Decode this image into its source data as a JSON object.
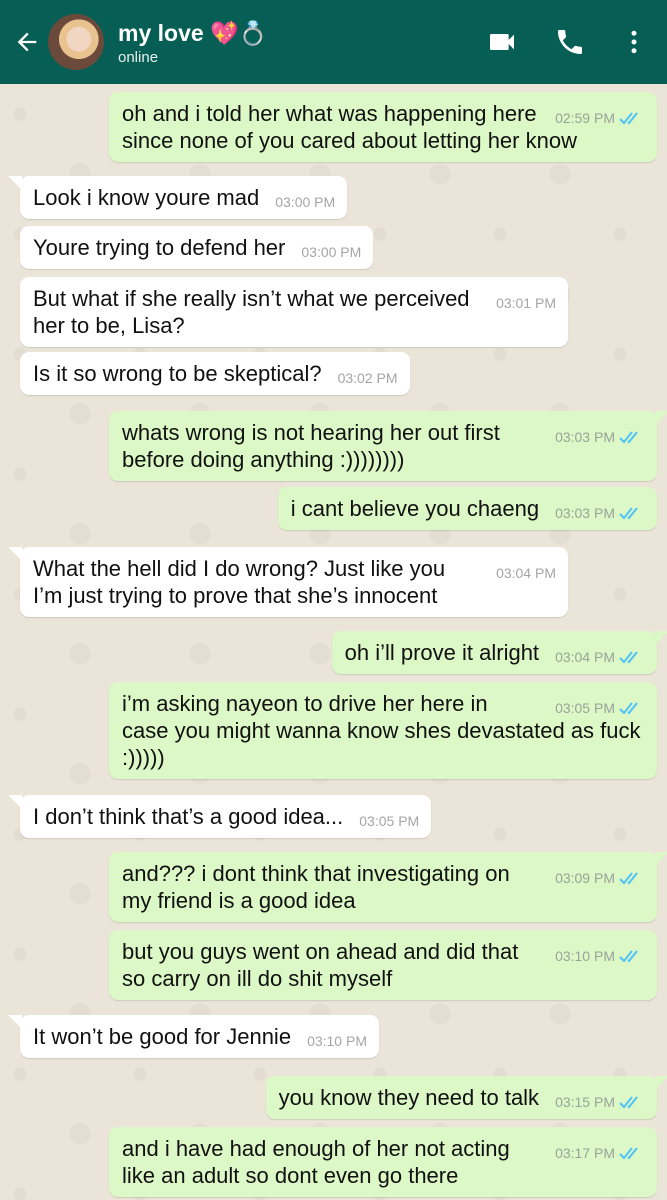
{
  "header": {
    "back_icon": "arrow-left-icon",
    "contact_name": "my love 💖💍",
    "status": "online",
    "icons": [
      "video-call-icon",
      "phone-icon",
      "more-vert-icon"
    ]
  },
  "colors": {
    "header": "#075e54",
    "outgoing_bubble": "#dcf8c6",
    "incoming_bubble": "#ffffff",
    "read_ticks": "#4fc3f7"
  },
  "messages": [
    {
      "dir": "out",
      "text": "oh and i told her what was happening here since none of you cared about letting her know",
      "time": "02:59 PM",
      "read": true
    },
    {
      "dir": "in",
      "text": "Look i know youre mad",
      "time": "03:00 PM"
    },
    {
      "dir": "in",
      "text": "Youre trying to defend her",
      "time": "03:00 PM"
    },
    {
      "dir": "in",
      "text": "But what if she really isn’t what we perceived her to be, Lisa?",
      "time": "03:01 PM"
    },
    {
      "dir": "in",
      "text": "Is it so wrong to be skeptical?",
      "time": "03:02 PM"
    },
    {
      "dir": "out",
      "text": "whats wrong is not hearing her out first before doing anything :))))))))",
      "time": "03:03 PM",
      "read": true
    },
    {
      "dir": "out",
      "text": "i cant believe you chaeng",
      "time": "03:03 PM",
      "read": true
    },
    {
      "dir": "in",
      "text": "What the hell did I do wrong? Just like you I’m just trying to prove that she’s innocent",
      "time": "03:04 PM"
    },
    {
      "dir": "out",
      "text": "oh i’ll prove it alright",
      "time": "03:04 PM",
      "read": true
    },
    {
      "dir": "out",
      "text": "i’m asking nayeon to drive her here in case you might wanna know shes devastated as fuck :)))))",
      "time": "03:05 PM",
      "read": true
    },
    {
      "dir": "in",
      "text": "I don’t think that’s a good idea...",
      "time": "03:05 PM"
    },
    {
      "dir": "out",
      "text": "and??? i dont think that investigating on my friend is a good idea",
      "time": "03:09 PM",
      "read": true
    },
    {
      "dir": "out",
      "text": "but you guys went on ahead and did that so carry on ill do shit myself",
      "time": "03:10 PM",
      "read": true
    },
    {
      "dir": "in",
      "text": "It won’t be good for Jennie",
      "time": "03:10 PM"
    },
    {
      "dir": "out",
      "text": "you know they need to talk",
      "time": "03:15 PM",
      "read": true
    },
    {
      "dir": "out",
      "text": "and i have had enough of her not acting like an adult so dont even go there",
      "time": "03:17 PM",
      "read": true
    }
  ]
}
